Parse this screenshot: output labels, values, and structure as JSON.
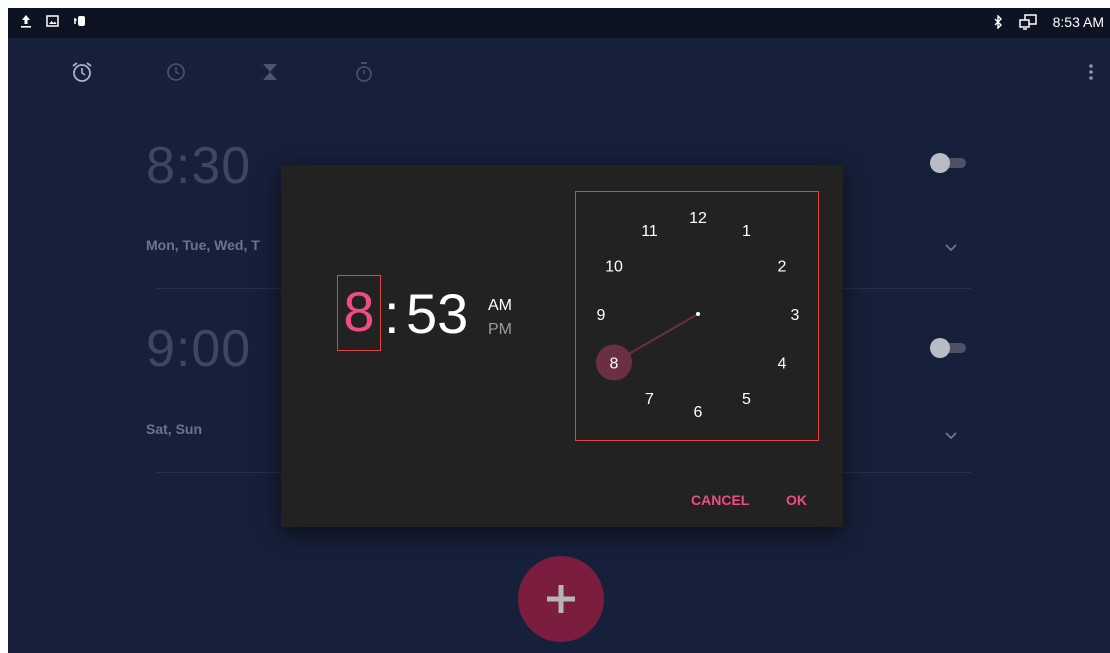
{
  "status_bar": {
    "left_icons": [
      "upload-icon",
      "image-icon",
      "usb-debug-icon"
    ],
    "right_icons": [
      "bluetooth-icon",
      "screen-cast-icon"
    ],
    "time": "8:53 AM"
  },
  "tabs": [
    "alarm-tab",
    "clock-tab",
    "timer-tab",
    "stopwatch-tab"
  ],
  "alarms": [
    {
      "time": "8:30",
      "days": "Mon, Tue, Wed, T",
      "enabled": false
    },
    {
      "time": "9:00",
      "days": "Sat, Sun",
      "enabled": false
    }
  ],
  "dialog": {
    "hour": "8",
    "separator": ":",
    "minute": "53",
    "am": "AM",
    "pm": "PM",
    "selected_period": "AM",
    "clock_numbers": [
      "12",
      "1",
      "2",
      "3",
      "4",
      "5",
      "6",
      "7",
      "8",
      "9",
      "10",
      "11"
    ],
    "selected_number": "8",
    "cancel": "CANCEL",
    "ok": "OK"
  },
  "colors": {
    "accent": "#ee4b87",
    "background": "#17203a",
    "dialog": "#222222",
    "highlight_box": "#e0463d"
  }
}
